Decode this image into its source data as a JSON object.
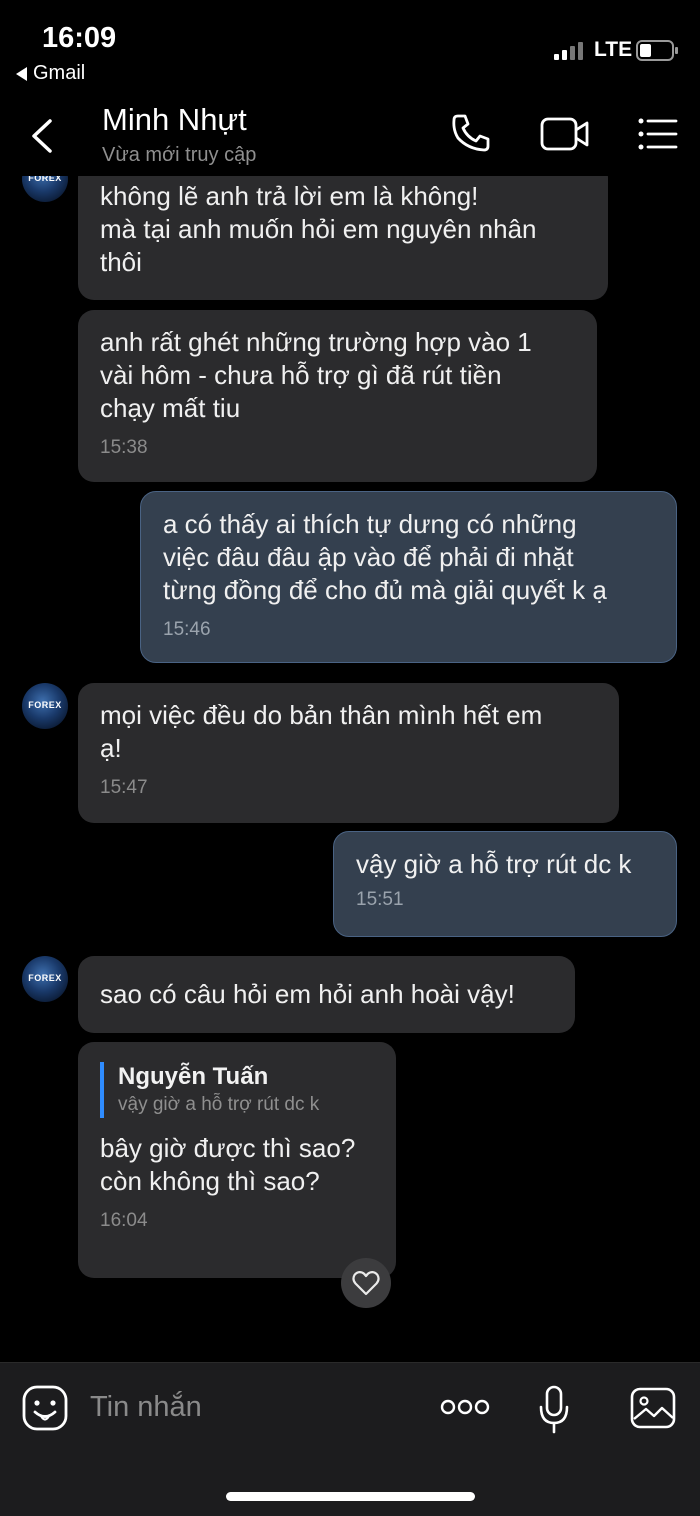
{
  "status_bar": {
    "time": "16:09",
    "back_app": "Gmail",
    "network": "LTE",
    "battery_level": 0.35
  },
  "header": {
    "contact_name": "Minh Nhựt",
    "contact_status": "Vừa mới truy cập",
    "back_icon": "chevron-left-icon",
    "call_icon": "phone-icon",
    "video_icon": "video-icon",
    "menu_icon": "list-menu-icon"
  },
  "avatar_label": "FOREX",
  "messages": [
    {
      "direction": "in",
      "text": "không lẽ anh trả lời em là không!\nmà tại anh muốn hỏi em nguyên nhân\nthôi",
      "time": ""
    },
    {
      "direction": "in",
      "text": "anh rất ghét những trường hợp vào 1\nvài hôm - chưa hỗ trợ gì đã rút tiền\nchạy mất tiu",
      "time": "15:38"
    },
    {
      "direction": "out",
      "text": "a có thấy ai thích tự dưng có những\nviệc đâu đâu ập vào để phải đi nhặt\ntừng đồng để cho đủ mà giải quyết k ạ",
      "time": "15:46"
    },
    {
      "direction": "in",
      "text": "mọi việc đều do bản thân mình hết em\nạ!",
      "time": "15:47"
    },
    {
      "direction": "out",
      "text": "vậy giờ a hỗ trợ rút dc k",
      "time": "15:51"
    },
    {
      "direction": "in",
      "text": "sao có câu hỏi em hỏi anh hoài vậy!",
      "time": ""
    },
    {
      "direction": "in",
      "reply_to": {
        "name": "Nguyễn Tuấn",
        "text": "vậy giờ a hỗ trợ rút dc k"
      },
      "text": "bây giờ được thì sao?\ncòn không thì sao?",
      "time": "16:04"
    }
  ],
  "input_bar": {
    "placeholder": "Tin nhắn",
    "sticker_icon": "sticker-icon",
    "more_icon": "more-dots-icon",
    "mic_icon": "microphone-icon",
    "image_icon": "image-icon"
  },
  "colors": {
    "background": "#000000",
    "incoming_bubble": "#2b2b2d",
    "outgoing_bubble": "#34404f",
    "outgoing_border": "#4a6384",
    "reply_accent": "#2f8cff"
  }
}
